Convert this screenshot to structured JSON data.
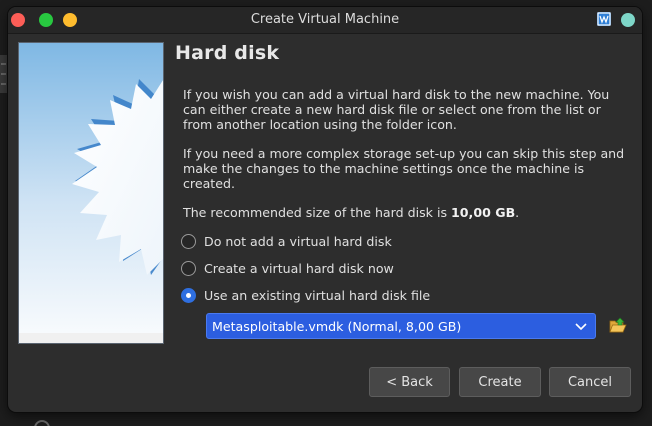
{
  "window": {
    "title": "Create Virtual Machine"
  },
  "page": {
    "heading": "Hard disk",
    "paragraph_1": "If you wish you can add a virtual hard disk to the new machine. You can either create a new hard disk file or select one from the list or from another location using the folder icon.",
    "paragraph_2": "If you need a more complex storage set-up you can skip this step and make the changes to the machine settings once the machine is created.",
    "recommended_prefix": "The recommended size of the hard disk is ",
    "recommended_size": "10,00 GB",
    "recommended_suffix": "."
  },
  "options": [
    {
      "label": "Do not add a virtual hard disk",
      "checked": false
    },
    {
      "label": "Create a virtual hard disk now",
      "checked": false
    },
    {
      "label": "Use an existing virtual hard disk file",
      "checked": true
    }
  ],
  "disk_select": {
    "value": "Metasploitable.vmdk (Normal, 8,00 GB)",
    "icon": "chevron-down-icon"
  },
  "folder_button": {
    "icon": "folder-open-icon"
  },
  "buttons": {
    "back": "< Back",
    "create": "Create",
    "cancel": "Cancel"
  },
  "colors": {
    "accent": "#2f6fe0",
    "select_bg": "#2c5ee0",
    "window_bg": "#2d2d2d"
  }
}
